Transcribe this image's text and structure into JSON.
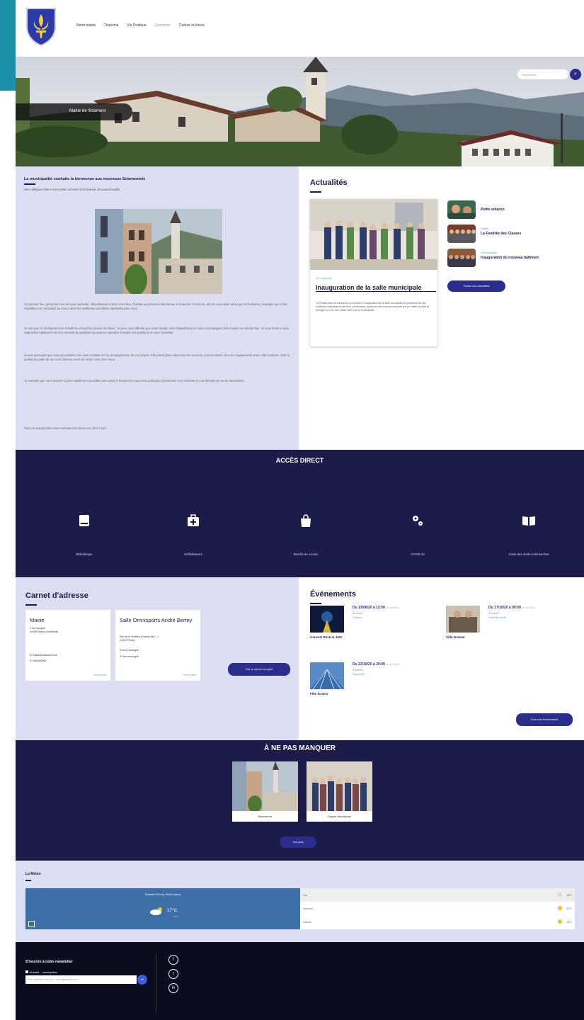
{
  "nav": [
    "Notre mairie",
    "Tourisme",
    "Vie Pratique",
    "Economie",
    "Culture et loisirs"
  ],
  "hero": {
    "caption": "Mairie de Sciament",
    "search_placeholder": "Rechercher...",
    "search_icon": "search-icon"
  },
  "welcome": {
    "title": "La municipalité souhaite la bienvenue aux nouveaux Sciamentois",
    "intro": "Nos collègues élus et moi-même sommes très heureux de vous accueillir.",
    "p1": "Ce premier lieu, permettez-moi de vous souhaiter, officiellement et avec mes élus, l'habitat au présent la bienvenue à Sciament. Vivement, afin de vous aider ainsi que les habitants, j'explique que notre installation se soit passé au mieux dans les meilleures conditions agréables pour vous.",
    "p2": "Je sais que ce changement de résidence est parfois source de stress. Je peux vous affirmer que notre équipe reste disponible pour vous accompagner dans toutes vos démarches. Je vous invite à nous rapprocher également de nos conseils de quartiers qui sauront répondre à toutes vos questions et vous conseiller.",
    "p3": "Je suis persuadé que vous accomplirez une vraie réussite en l'accompagnement de vos projets. Elle prend place dans tous les secteurs, tous les loisirs, tous les équipements d'une ville moderne, dont la qualité du cadre de vie vous donnera envie de rester vivre chez nous.",
    "p4": "Je souhaite que vous trouviez le plus rapidement possible votre place à Sciament et que vous participiez pleinement à sa richesse et à la diversité de sa vie associative.",
    "p5": "Tous les Sciamentois vous souhaitent la bienvenue chez nous !"
  },
  "news": {
    "title": "Actualités",
    "main": {
      "category": "Vie municipale",
      "title": "Inauguration de la salle municipale",
      "desc": "Le 3 septembre la commune a procédé à l'inauguration de la salle municipale en présence de très nombreux habitants et des élus communaux. Après les discours les convives ont pu visiter la salle et partager le verre de l'amitié offert par la municipalité."
    },
    "items": [
      {
        "category": "",
        "title": "Petite enfance"
      },
      {
        "category": "Culture",
        "title": "La Fondrée des Classes"
      },
      {
        "category": "Vie municipale",
        "title": "Inauguration du nouveau bâtiment"
      }
    ],
    "button": "Toutes nos actualités"
  },
  "acces": {
    "title": "ACCÈS DIRECT",
    "items": [
      {
        "label": "Bibliothèque",
        "icon": "book-icon"
      },
      {
        "label": "Défibrillateurs",
        "icon": "medkit-icon"
      },
      {
        "label": "Marché de Locaux",
        "icon": "shopping-bag-icon"
      },
      {
        "label": "COVID-19",
        "icon": "gears-icon"
      },
      {
        "label": "Guide des droits et démarches",
        "icon": "open-book-icon"
      }
    ]
  },
  "carnet": {
    "title": "Carnet d'adresse",
    "cards": [
      {
        "title": "Mairie",
        "address": "2 rue Sacquet\n01000 Ferney-Chambellin",
        "email": "mairie@sciament.com",
        "phone": "0450000000",
        "more": "Voir la fiche"
      },
      {
        "title": "Salle Omnisports André Bertey",
        "address": "Rue de la Fruitière (Chemin des ...)\n01000 Ferney",
        "email": "Non renseigné",
        "phone": "Non renseigné",
        "more": "Voir la fiche"
      }
    ],
    "button": "Voir le carnet complet"
  },
  "events": {
    "title": "Événements",
    "items": [
      {
        "date": "Du 13/06/20 à 12:00",
        "date_end": "au 14/06/20",
        "location": "Sciament",
        "category": "Concert",
        "name": "Concert Rock et Jazz"
      },
      {
        "date": "Du 17/10/20 à 09:00",
        "date_end": "au 17/10/20",
        "location": "Sciament",
        "category": "Foire/Brocante",
        "name": "Vide-Grenier"
      },
      {
        "date": "Du 23/10/20 à 20:00",
        "date_end": "au 24/10/20",
        "location": "Sciament",
        "category": "Spectacle",
        "name": "Fête foraine"
      }
    ],
    "button": "Tous nos événements"
  },
  "manquer": {
    "title": "À NE PAS MANQUER",
    "items": [
      {
        "label": "Bienvenue"
      },
      {
        "label": "Equipe Municipale"
      }
    ],
    "button": "Voir plus"
  },
  "meteo": {
    "title": "La Météo",
    "caption": "Sciament (Ferney, Rhône-Alpes)",
    "temp": "17°C",
    "feel": "19°C",
    "forecast": [
      {
        "day": "Jeu",
        "temp": "18°C"
      },
      {
        "day": "Vendredi",
        "temp": "19°C"
      },
      {
        "day": "Samedi",
        "temp": "18°C"
      }
    ]
  },
  "footer": {
    "newsletter_title": "S'inscrire à notre newsletter",
    "checkbox_label": "Actualit... municipales",
    "input_placeholder": "Votre adresse email (ex : dupont@gmail.com)",
    "submit": "ok",
    "social": [
      "facebook-icon",
      "twitter-icon",
      "linkedin-icon"
    ]
  },
  "colors": {
    "navy": "#1b1c4a",
    "lavender": "#dcdff3",
    "accent": "#2b2d8c",
    "teal": "#1b8fa8"
  }
}
